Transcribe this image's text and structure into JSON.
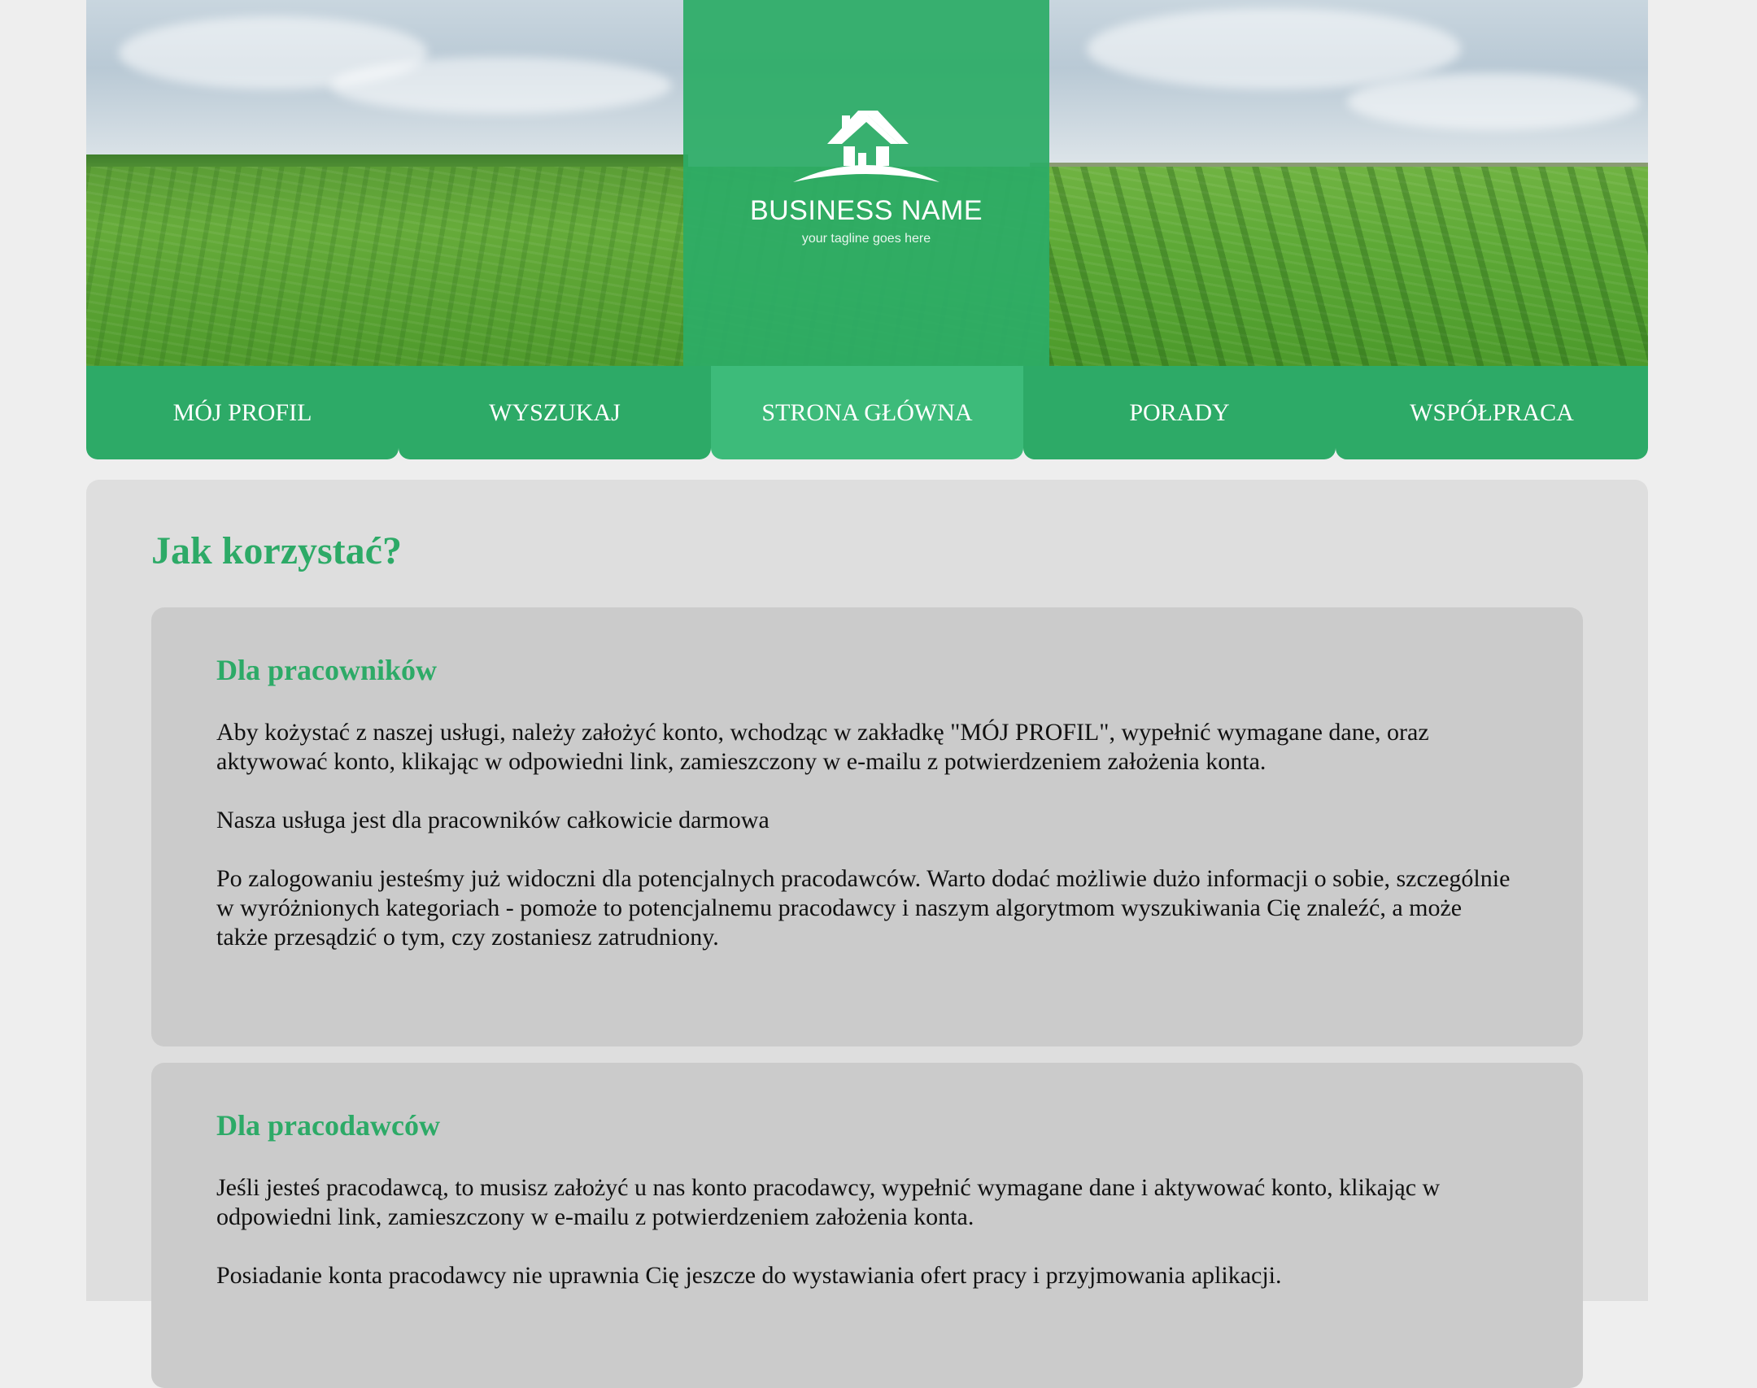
{
  "header": {
    "logo_name": "BUSINESS NAME",
    "logo_tagline": "your tagline goes here",
    "logo_icon": "house-icon"
  },
  "nav": {
    "items": [
      {
        "label": "MÓJ PROFIL"
      },
      {
        "label": "WYSZUKAJ"
      },
      {
        "label": "STRONA GŁÓWNA"
      },
      {
        "label": "PORADY"
      },
      {
        "label": "WSPÓŁPRACA"
      }
    ],
    "active_index": 2
  },
  "main": {
    "title": "Jak korzystać?",
    "sections": [
      {
        "heading": "Dla pracowników",
        "paragraphs": [
          "Aby kożystać z naszej usługi, należy założyć konto, wchodząc w zakładkę \"MÓJ PROFIL\", wypełnić wymagane dane, oraz aktywować konto, klikając w odpowiedni link, zamieszczony w e-mailu z potwierdzeniem założenia konta.",
          "Nasza usługa jest dla pracowników całkowicie darmowa",
          "Po zalogowaniu jesteśmy już widoczni dla potencjalnych pracodawców. Warto dodać możliwie dużo informacji o sobie, szczególnie w wyróżnionych kategoriach - pomoże to potencjalnemu pracodawcy i naszym algorytmom wyszukiwania Cię znaleźć, a może także przesądzić o tym, czy zostaniesz zatrudniony."
        ]
      },
      {
        "heading": "Dla pracodawców",
        "paragraphs": [
          "Jeśli jesteś pracodawcą, to musisz założyć u nas konto pracodawcy, wypełnić wymagane dane i aktywować konto, klikając w odpowiedni link, zamieszczony w e-mailu z potwierdzeniem założenia konta.",
          "Posiadanie konta pracodawcy nie uprawnia Cię jeszcze do wystawiania ofert pracy i przyjmowania aplikacji."
        ]
      }
    ]
  },
  "colors": {
    "accent": "#2daa67",
    "accent_active": "#3dbb7a",
    "page_bg": "#eeeeee",
    "main_bg": "#dedede",
    "card_bg": "#cbcbcb"
  }
}
